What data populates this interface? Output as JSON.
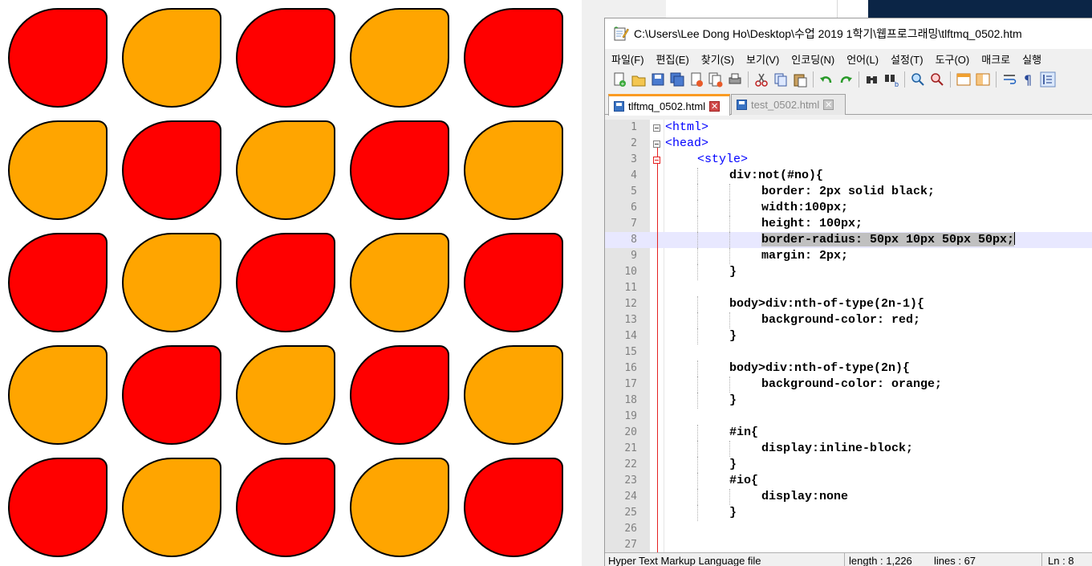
{
  "drops": {
    "colors": {
      "red": "#ff0000",
      "orange": "#ffa500"
    },
    "rows": [
      [
        "red",
        "orange",
        "red",
        "orange",
        "red"
      ],
      [
        "orange",
        "red",
        "orange",
        "red",
        "orange"
      ],
      [
        "red",
        "orange",
        "red",
        "orange",
        "red"
      ],
      [
        "orange",
        "red",
        "orange",
        "red",
        "orange"
      ],
      [
        "red",
        "orange",
        "red",
        "orange",
        "red"
      ]
    ]
  },
  "window": {
    "title": "C:\\Users\\Lee Dong Ho\\Desktop\\수업 2019 1학기\\웹프로그래밍\\tlftmq_0502.htm",
    "title_icon": "notepad-icon"
  },
  "menu": [
    "파일(F)",
    "편집(E)",
    "찾기(S)",
    "보기(V)",
    "인코딩(N)",
    "언어(L)",
    "설정(T)",
    "도구(O)",
    "매크로",
    "실행"
  ],
  "toolbar_icons": [
    "new-file-icon",
    "open-file-icon",
    "save-icon",
    "save-all-icon",
    "close-icon",
    "close-all-icon",
    "print-icon",
    "|",
    "cut-icon",
    "copy-icon",
    "paste-icon",
    "|",
    "undo-icon",
    "redo-icon",
    "|",
    "find-icon",
    "replace-icon",
    "|",
    "zoom-in-icon",
    "zoom-out-icon",
    "|",
    "sync-vertical-icon",
    "sync-horizontal-icon",
    "|",
    "word-wrap-icon",
    "show-all-chars-icon",
    "indent-guide-icon"
  ],
  "tabs": [
    {
      "label": "tlftmq_0502.html",
      "active": true
    },
    {
      "label": "test_0502.html",
      "active": false
    }
  ],
  "editor": {
    "current_line": 8,
    "lines": [
      {
        "n": "1",
        "text": "<html>",
        "kind": "tag",
        "indent": 0
      },
      {
        "n": "2",
        "text": "<head>",
        "kind": "tag",
        "indent": 0
      },
      {
        "n": "3",
        "text": "<style>",
        "kind": "tag",
        "indent": 1
      },
      {
        "n": "4",
        "text": "div:not(#no){",
        "kind": "css",
        "indent": 2
      },
      {
        "n": "5",
        "text": "border: 2px solid black;",
        "kind": "css",
        "indent": 3
      },
      {
        "n": "6",
        "text": "width:100px;",
        "kind": "css",
        "indent": 3
      },
      {
        "n": "7",
        "text": "height: 100px;",
        "kind": "css",
        "indent": 3
      },
      {
        "n": "8",
        "text": "border-radius: 50px 10px 50px 50px;",
        "kind": "css",
        "indent": 3,
        "selected": true
      },
      {
        "n": "9",
        "text": "margin: 2px;",
        "kind": "css",
        "indent": 3
      },
      {
        "n": "10",
        "text": "}",
        "kind": "css",
        "indent": 2
      },
      {
        "n": "11",
        "text": "",
        "kind": "css",
        "indent": 0
      },
      {
        "n": "12",
        "text": "body>div:nth-of-type(2n-1){",
        "kind": "css",
        "indent": 2
      },
      {
        "n": "13",
        "text": "background-color: red;",
        "kind": "css",
        "indent": 3
      },
      {
        "n": "14",
        "text": "}",
        "kind": "css",
        "indent": 2
      },
      {
        "n": "15",
        "text": "",
        "kind": "css",
        "indent": 0
      },
      {
        "n": "16",
        "text": "body>div:nth-of-type(2n){",
        "kind": "css",
        "indent": 2
      },
      {
        "n": "17",
        "text": "background-color: orange;",
        "kind": "css",
        "indent": 3
      },
      {
        "n": "18",
        "text": "}",
        "kind": "css",
        "indent": 2
      },
      {
        "n": "19",
        "text": "",
        "kind": "css",
        "indent": 0
      },
      {
        "n": "20",
        "text": "#in{",
        "kind": "css",
        "indent": 2
      },
      {
        "n": "21",
        "text": "display:inline-block;",
        "kind": "css",
        "indent": 3
      },
      {
        "n": "22",
        "text": "}",
        "kind": "css",
        "indent": 2
      },
      {
        "n": "23",
        "text": "#io{",
        "kind": "css",
        "indent": 2
      },
      {
        "n": "24",
        "text": "display:none",
        "kind": "css",
        "indent": 3
      },
      {
        "n": "25",
        "text": "}",
        "kind": "css",
        "indent": 2
      },
      {
        "n": "26",
        "text": "",
        "kind": "css",
        "indent": 0
      },
      {
        "n": "27",
        "text": "",
        "kind": "css",
        "indent": 0
      }
    ]
  },
  "status": {
    "file_type": "Hyper Text Markup Language file",
    "length": "length : 1,226",
    "lines": "lines : 67",
    "ln": "Ln : 8"
  }
}
